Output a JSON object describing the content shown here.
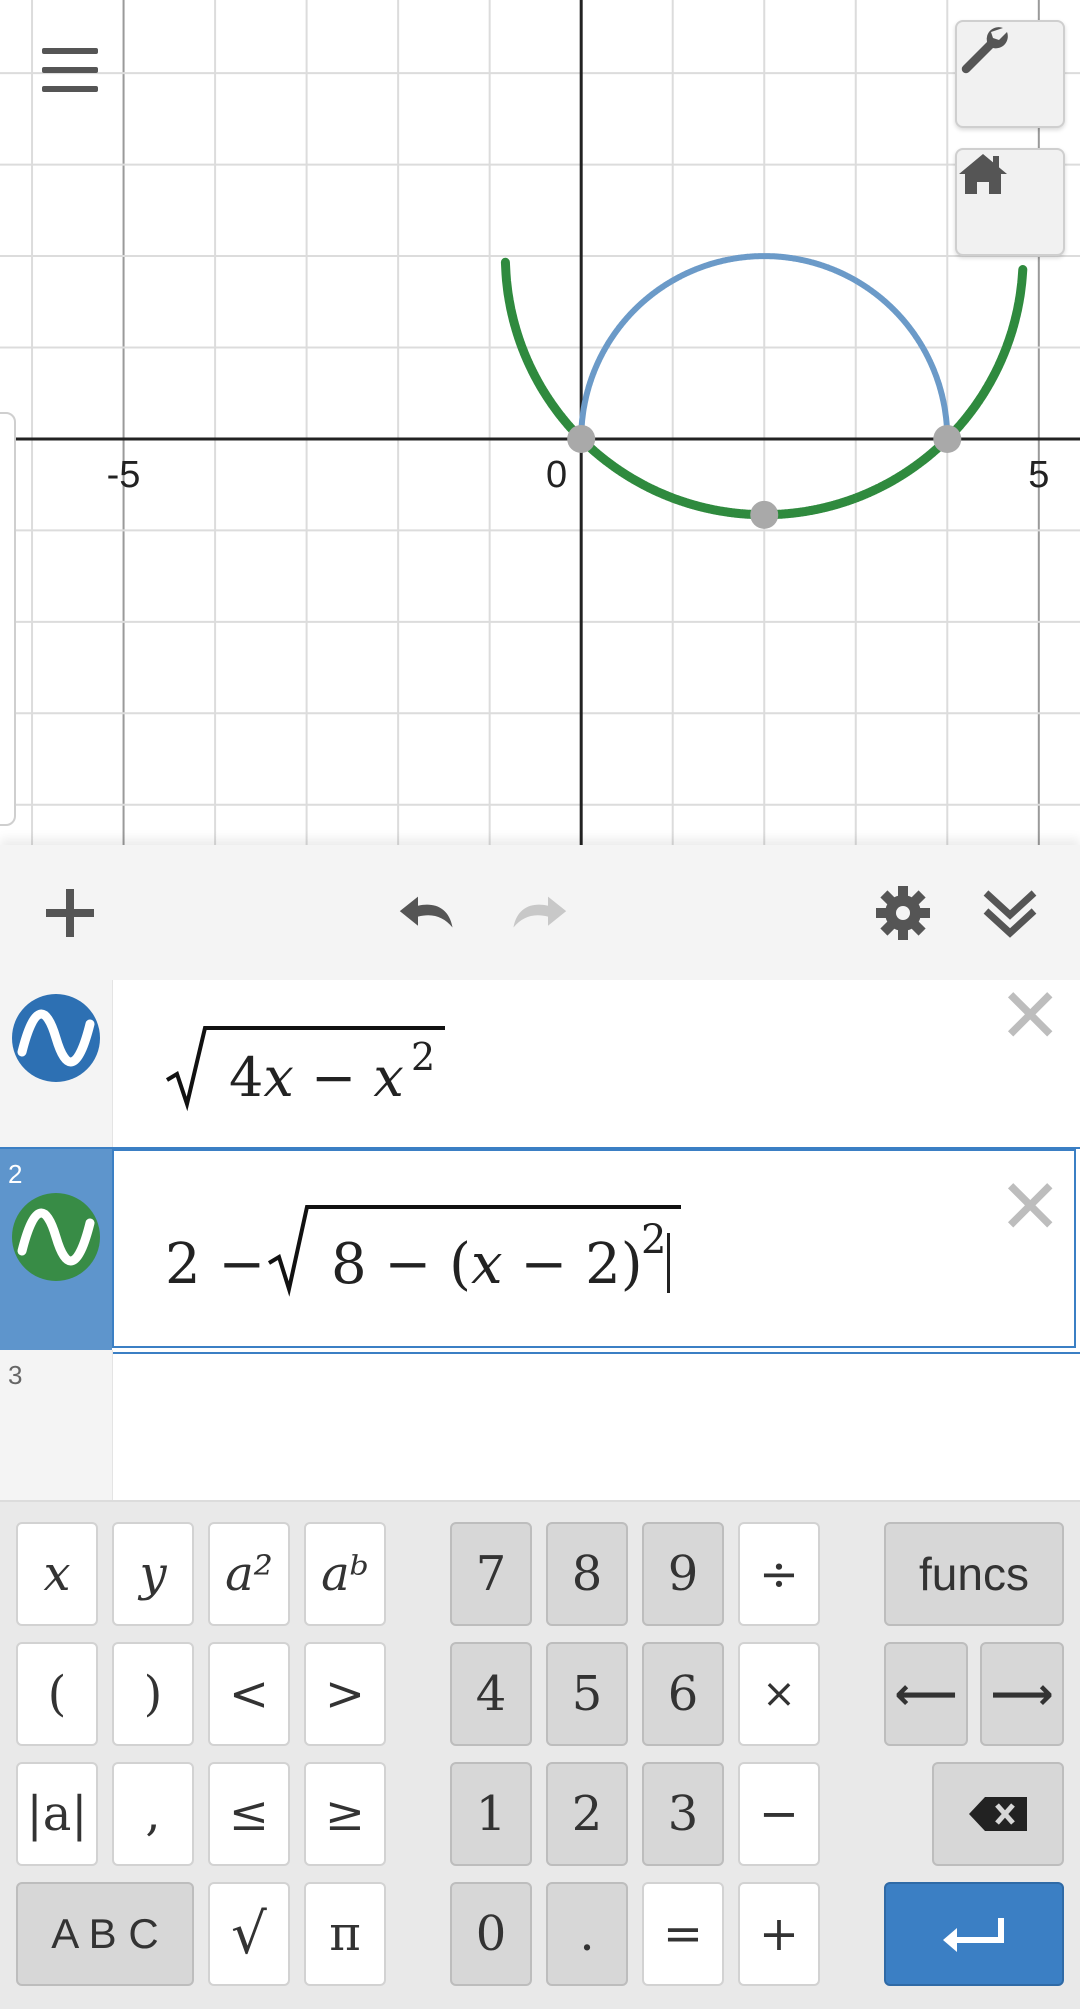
{
  "graph": {
    "axis": {
      "x_min": -6.35,
      "x_max": 5.45,
      "y_min": -4.44,
      "y_max": 4.8,
      "grid_step": 1,
      "major_step": 5,
      "x_tick_labels": [
        "-5",
        "0",
        "5"
      ]
    },
    "curves": [
      {
        "label": "curve-1",
        "expression": "sqrt(4x - x^2)",
        "color": "#6b9ac8"
      },
      {
        "label": "curve-2",
        "expression": "2 - sqrt(8 - (x - 2)^2)",
        "color": "#2f8a3e"
      }
    ],
    "points": [
      {
        "x": 0,
        "y": 0
      },
      {
        "x": 4,
        "y": 0
      },
      {
        "x": 2,
        "y": -0.83
      }
    ]
  },
  "controls": {
    "menu_icon": "hamburger-icon",
    "wrench_icon": "wrench-icon",
    "home_icon": "home-icon"
  },
  "toolbar": {
    "add_icon": "plus-icon",
    "undo_icon": "undo-icon",
    "redo_icon": "redo-icon",
    "settings_icon": "gear-icon",
    "collapse_icon": "double-chevron-down-icon"
  },
  "expressions": [
    {
      "number": "",
      "color": "#2d70b3",
      "active": false
    },
    {
      "number": "2",
      "color": "#388c46",
      "active": true
    },
    {
      "number": "3",
      "active": false
    }
  ],
  "keypad": {
    "left": [
      [
        "x",
        "y",
        "a²",
        "aᵇ"
      ],
      [
        "(",
        ")",
        "<",
        ">"
      ],
      [
        "|a|",
        ",",
        "≤",
        "≥"
      ],
      [
        "A B C",
        "√",
        "π"
      ]
    ],
    "numbers": [
      [
        "7",
        "8",
        "9",
        "÷"
      ],
      [
        "4",
        "5",
        "6",
        "×"
      ],
      [
        "1",
        "2",
        "3",
        "−"
      ],
      [
        "0",
        ".",
        "=",
        "+"
      ]
    ],
    "funcs_label": "funcs",
    "left_arrow": "⟵",
    "right_arrow": "⟶"
  }
}
